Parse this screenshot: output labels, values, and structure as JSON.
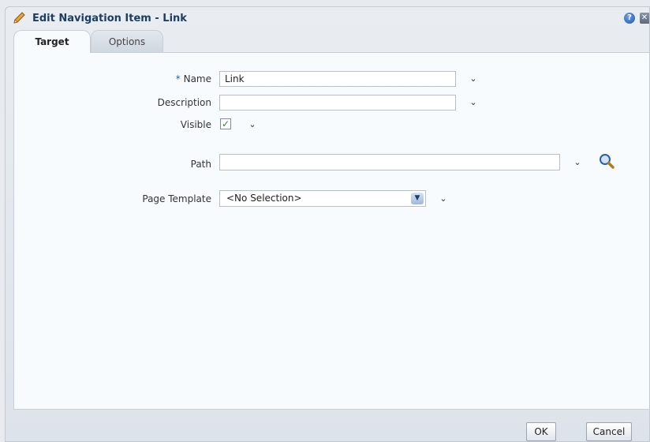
{
  "dialog": {
    "title": "Edit Navigation Item - Link",
    "help_label": "?",
    "close_label": "✕"
  },
  "tabs": [
    {
      "label": "Target"
    },
    {
      "label": "Options"
    }
  ],
  "form": {
    "name": {
      "required_marker": "*",
      "label": "Name",
      "value": "Link"
    },
    "description": {
      "label": "Description",
      "value": ""
    },
    "visible": {
      "label": "Visible",
      "checked": true
    },
    "path": {
      "label": "Path",
      "value": ""
    },
    "page_template": {
      "label": "Page Template",
      "value": "<No Selection>"
    }
  },
  "icons": {
    "chevron": "chevron-down-icon",
    "search": "search-icon",
    "title": "pencil-icon"
  },
  "buttons": {
    "ok": "OK",
    "cancel": "Cancel"
  }
}
